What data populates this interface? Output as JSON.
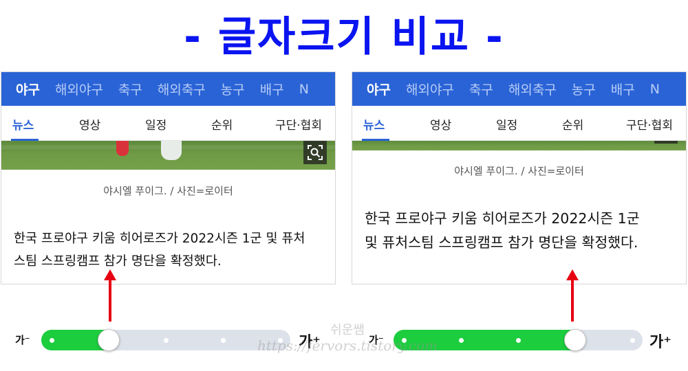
{
  "title": "- 글자크기 비교 -",
  "panels": [
    {
      "top_tabs": [
        "야구",
        "해외야구",
        "축구",
        "해외축구",
        "농구",
        "배구",
        "N"
      ],
      "sub_tabs": [
        "뉴스",
        "영상",
        "일정",
        "순위",
        "구단·협회"
      ],
      "caption": "야시엘 푸이그. / 사진=로이터",
      "article_line1": "한국 프로야구 키움 히어로즈가 2022시즌 1군 및 퓨처",
      "article_line2": "스팀 스프링캠프 참가 명단을 확정했다."
    },
    {
      "top_tabs": [
        "야구",
        "해외야구",
        "축구",
        "해외축구",
        "농구",
        "배구",
        "N"
      ],
      "sub_tabs": [
        "뉴스",
        "영상",
        "일정",
        "순위",
        "구단·협회"
      ],
      "caption": "야시엘 푸이그. / 사진=로이터",
      "article_line1": "한국 프로야구 키움 히어로즈가 2022시즌 1군",
      "article_line2": "및 퓨처스팀 스프링캠프 참가 명단을 확정했다."
    }
  ],
  "sliders": [
    {
      "small_label": "가⁻",
      "large_label": "가⁺",
      "level": 0.25,
      "steps": 5
    },
    {
      "small_label": "가⁻",
      "large_label": "가⁺",
      "level": 0.75,
      "steps": 5
    }
  ],
  "watermark_line1": "쉬운쌤",
  "watermark_line2": "https://fervors.tistory.com",
  "colors": {
    "title": "#0a14f0",
    "nav_blue": "#2a63d6",
    "slider_green": "#1ccd3e",
    "arrow_red": "#e60012"
  }
}
